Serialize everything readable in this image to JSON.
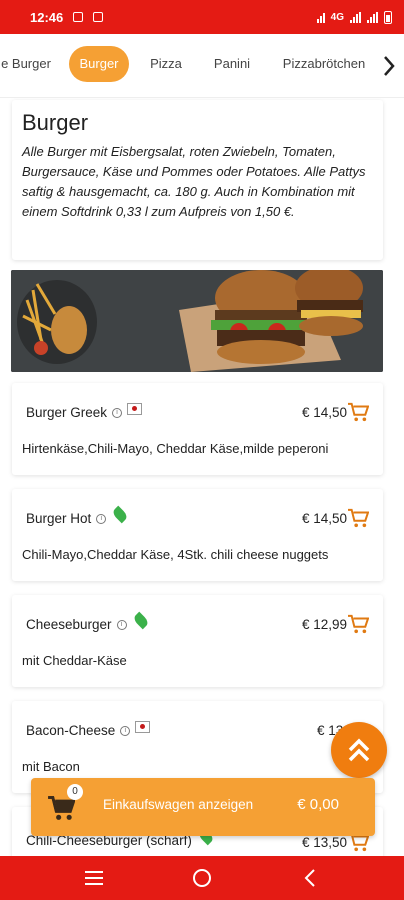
{
  "status_bar": {
    "time": "12:46",
    "network": "4G"
  },
  "categories": {
    "items": [
      {
        "label": "e Burger",
        "active": false
      },
      {
        "label": "Burger",
        "active": true
      },
      {
        "label": "Pizza",
        "active": false
      },
      {
        "label": "Panini",
        "active": false
      },
      {
        "label": "Pizzabrötchen",
        "active": false
      }
    ],
    "next_icon": "chevron-right-icon"
  },
  "section": {
    "title": "Burger",
    "description": "Alle Burger mit Eisbergsalat, roten Zwiebeln, Tomaten, Burgersauce, Käse und Pommes oder Potatoes. Alle Pattys saftig & hausgemacht, ca. 180 g. Auch in Kombination mit einem Softdrink 0,33 l zum Aufpreis von 1,50 €."
  },
  "products": [
    {
      "name": "Burger Greek",
      "price": "€ 14,50",
      "description": "Hirtenkäse,Chili-Mayo, Cheddar Käse,milde peperoni",
      "badge": "flag-icon"
    },
    {
      "name": "Burger Hot",
      "price": "€ 14,50",
      "description": "Chili-Mayo,Cheddar Käse, 4Stk. chili cheese nuggets",
      "badge": "leaf-icon"
    },
    {
      "name": "Cheeseburger",
      "price": "€ 12,99",
      "description": "mit Cheddar-Käse",
      "badge": "leaf-icon"
    },
    {
      "name": "Bacon-Cheese",
      "price": "€ 13,",
      "description": "mit Bacon",
      "badge": "flag-icon"
    },
    {
      "name": "Chili-Cheeseburger (scharf)",
      "price": "€ 13,50",
      "description": "",
      "badge": "leaf-icon"
    }
  ],
  "cart": {
    "count": "0",
    "label": "Einkaufswagen anzeigen",
    "total": "€ 0,00"
  },
  "colors": {
    "brand_red": "#e41b14",
    "accent_orange": "#f5a034",
    "scroll_button": "#f07d0f",
    "cart_icon": "#e07a12"
  }
}
